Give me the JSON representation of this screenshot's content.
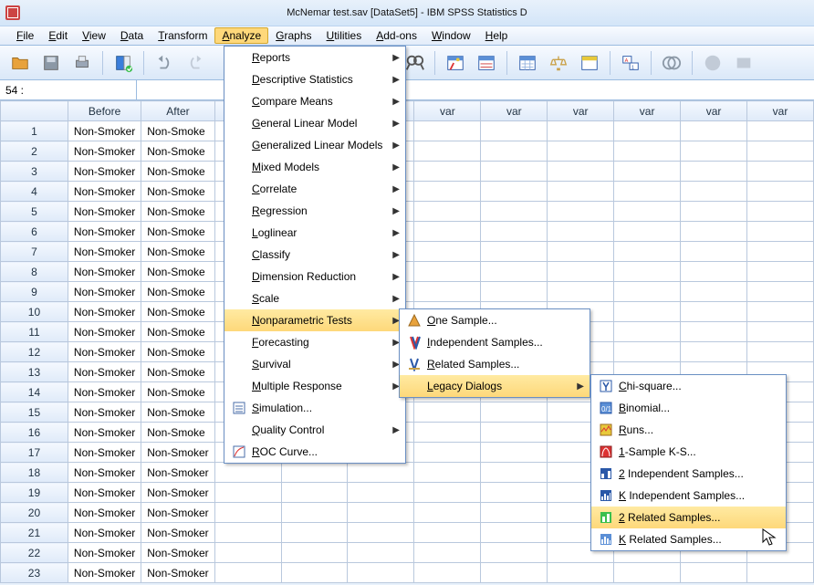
{
  "title": "McNemar test.sav [DataSet5] - IBM SPSS Statistics D",
  "menubar": [
    "File",
    "Edit",
    "View",
    "Data",
    "Transform",
    "Analyze",
    "Graphs",
    "Utilities",
    "Add-ons",
    "Window",
    "Help"
  ],
  "menubar_open_index": 5,
  "namebox": "54 :",
  "columns": [
    "",
    "Before",
    "After",
    "var",
    "var",
    "var",
    "var",
    "var",
    "var",
    "var",
    "var",
    "var"
  ],
  "rows": [
    {
      "n": "1",
      "b": "Non-Smoker",
      "a": "Non-Smoke"
    },
    {
      "n": "2",
      "b": "Non-Smoker",
      "a": "Non-Smoke"
    },
    {
      "n": "3",
      "b": "Non-Smoker",
      "a": "Non-Smoke"
    },
    {
      "n": "4",
      "b": "Non-Smoker",
      "a": "Non-Smoke"
    },
    {
      "n": "5",
      "b": "Non-Smoker",
      "a": "Non-Smoke"
    },
    {
      "n": "6",
      "b": "Non-Smoker",
      "a": "Non-Smoke"
    },
    {
      "n": "7",
      "b": "Non-Smoker",
      "a": "Non-Smoke"
    },
    {
      "n": "8",
      "b": "Non-Smoker",
      "a": "Non-Smoke"
    },
    {
      "n": "9",
      "b": "Non-Smoker",
      "a": "Non-Smoke"
    },
    {
      "n": "10",
      "b": "Non-Smoker",
      "a": "Non-Smoke"
    },
    {
      "n": "11",
      "b": "Non-Smoker",
      "a": "Non-Smoke"
    },
    {
      "n": "12",
      "b": "Non-Smoker",
      "a": "Non-Smoke"
    },
    {
      "n": "13",
      "b": "Non-Smoker",
      "a": "Non-Smoke"
    },
    {
      "n": "14",
      "b": "Non-Smoker",
      "a": "Non-Smoke"
    },
    {
      "n": "15",
      "b": "Non-Smoker",
      "a": "Non-Smoke"
    },
    {
      "n": "16",
      "b": "Non-Smoker",
      "a": "Non-Smoke"
    },
    {
      "n": "17",
      "b": "Non-Smoker",
      "a": "Non-Smoker"
    },
    {
      "n": "18",
      "b": "Non-Smoker",
      "a": "Non-Smoker"
    },
    {
      "n": "19",
      "b": "Non-Smoker",
      "a": "Non-Smoker"
    },
    {
      "n": "20",
      "b": "Non-Smoker",
      "a": "Non-Smoker"
    },
    {
      "n": "21",
      "b": "Non-Smoker",
      "a": "Non-Smoker"
    },
    {
      "n": "22",
      "b": "Non-Smoker",
      "a": "Non-Smoker"
    },
    {
      "n": "23",
      "b": "Non-Smoker",
      "a": "Non-Smoker"
    }
  ],
  "analyze_menu": {
    "items": [
      {
        "label": "Reports",
        "arrow": true
      },
      {
        "label": "Descriptive Statistics",
        "arrow": true
      },
      {
        "label": "Compare Means",
        "arrow": true
      },
      {
        "label": "General Linear Model",
        "arrow": true
      },
      {
        "label": "Generalized Linear Models",
        "arrow": true
      },
      {
        "label": "Mixed Models",
        "arrow": true
      },
      {
        "label": "Correlate",
        "arrow": true
      },
      {
        "label": "Regression",
        "arrow": true
      },
      {
        "label": "Loglinear",
        "arrow": true
      },
      {
        "label": "Classify",
        "arrow": true
      },
      {
        "label": "Dimension Reduction",
        "arrow": true
      },
      {
        "label": "Scale",
        "arrow": true
      },
      {
        "label": "Nonparametric Tests",
        "arrow": true,
        "hi": true
      },
      {
        "label": "Forecasting",
        "arrow": true
      },
      {
        "label": "Survival",
        "arrow": true
      },
      {
        "label": "Multiple Response",
        "arrow": true
      },
      {
        "label": "Simulation...",
        "arrow": false,
        "icon": "sim"
      },
      {
        "label": "Quality Control",
        "arrow": true
      },
      {
        "label": "ROC Curve...",
        "arrow": false,
        "icon": "roc"
      }
    ]
  },
  "nonparam_sub": {
    "items": [
      {
        "label": "One Sample...",
        "icon": "one"
      },
      {
        "label": "Independent Samples...",
        "icon": "ind"
      },
      {
        "label": "Related Samples...",
        "icon": "rel"
      },
      {
        "label": "Legacy Dialogs",
        "arrow": true,
        "hi": true
      }
    ]
  },
  "legacy_sub": {
    "items": [
      {
        "label": "Chi-square...",
        "icon": "chi"
      },
      {
        "label": "Binomial...",
        "icon": "bin"
      },
      {
        "label": "Runs...",
        "icon": "run"
      },
      {
        "label": "1-Sample K-S...",
        "icon": "ks"
      },
      {
        "label": "2 Independent Samples...",
        "icon": "2i"
      },
      {
        "label": "K Independent Samples...",
        "icon": "ki"
      },
      {
        "label": "2 Related Samples...",
        "icon": "2r",
        "hi": true
      },
      {
        "label": "K Related Samples...",
        "icon": "kr"
      }
    ]
  }
}
